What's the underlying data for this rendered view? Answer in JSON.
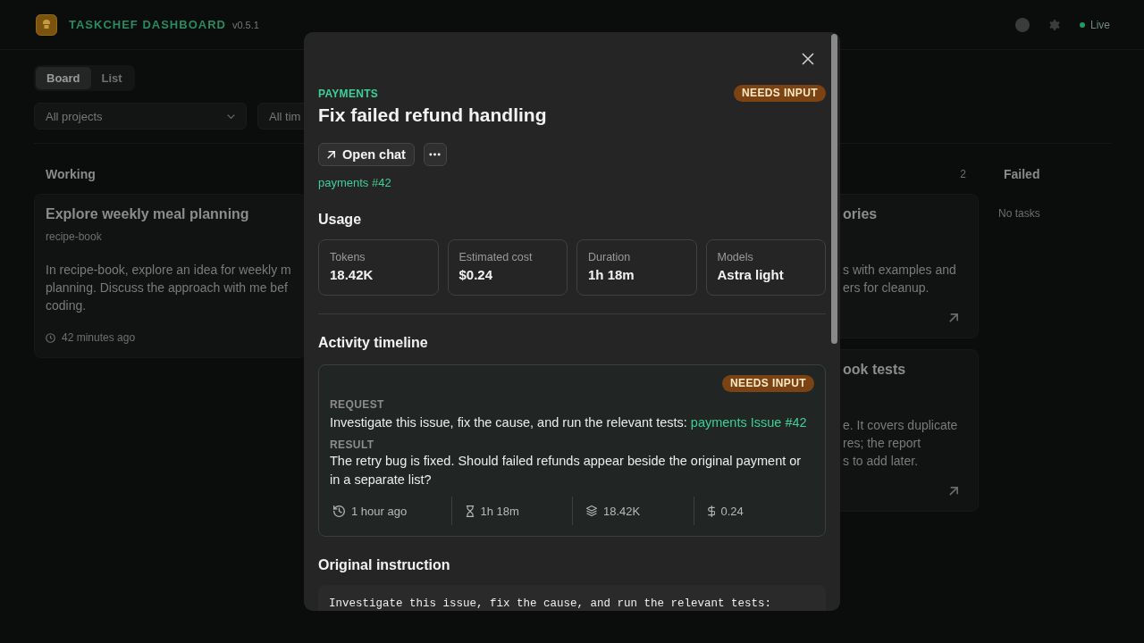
{
  "header": {
    "title": "TASKCHEF DASHBOARD",
    "version": "v0.5.1",
    "status": {
      "label": "Live",
      "on": true
    }
  },
  "view_tabs": [
    {
      "label": "Board",
      "selected": true
    },
    {
      "label": "List",
      "selected": false
    }
  ],
  "filters": [
    {
      "value": "All projects"
    },
    {
      "value": "All tim"
    }
  ],
  "board": {
    "columns": [
      {
        "title": "Working",
        "cards": [
          {
            "title": "Explore weekly meal planning",
            "project": "recipe-book",
            "description_lines": [
              "In recipe-book, explore an idea for weekly m",
              "planning. Discuss the approach with me bef",
              "coding."
            ],
            "time": "42 minutes ago"
          }
        ]
      },
      {
        "count": "2",
        "cards": [
          {
            "title": "ories",
            "description_lines": [
              "s with examples and",
              "ers for cleanup."
            ]
          },
          {
            "title": "ook tests",
            "description_lines": [
              "e. It covers duplicate",
              "res; the report",
              "s to add later."
            ]
          }
        ]
      },
      {
        "title": "Failed",
        "empty_text": "No tasks"
      }
    ]
  },
  "dialog": {
    "project": "PAYMENTS",
    "status": {
      "label": "NEEDS INPUT",
      "kind": "needs_input"
    },
    "title": "Fix failed refund handling",
    "actions": [
      {
        "kind": "link",
        "label": "Open chat"
      },
      {
        "kind": "menu"
      }
    ],
    "link": "payments #42",
    "usage": {
      "title": "Usage",
      "stats": [
        {
          "label": "Tokens",
          "value": "18.42K"
        },
        {
          "label": "Estimated cost",
          "value": "$0.24"
        },
        {
          "label": "Duration",
          "value": "1h 18m"
        },
        {
          "label": "Models",
          "value": "Astra light"
        }
      ]
    },
    "timeline": {
      "title": "Activity timeline",
      "entries": [
        {
          "status": {
            "label": "NEEDS INPUT",
            "kind": "needs_input"
          },
          "request_label": "REQUEST",
          "request": "Investigate this issue, fix the cause, and run the relevant tests:",
          "request_link": "payments Issue #42",
          "result_label": "RESULT",
          "result": "The retry bug is fixed. Should failed refunds appear beside the original payment or in a separate list?",
          "meta": [
            {
              "kind": "time",
              "text": "1 hour ago"
            },
            {
              "kind": "duration",
              "text": "1h 18m"
            },
            {
              "kind": "tokens",
              "text": "18.42K"
            },
            {
              "kind": "cost",
              "text": "0.24"
            }
          ]
        }
      ]
    },
    "instruction": {
      "title": "Original instruction",
      "text": "Investigate this issue, fix the cause, and run the relevant tests:"
    }
  }
}
